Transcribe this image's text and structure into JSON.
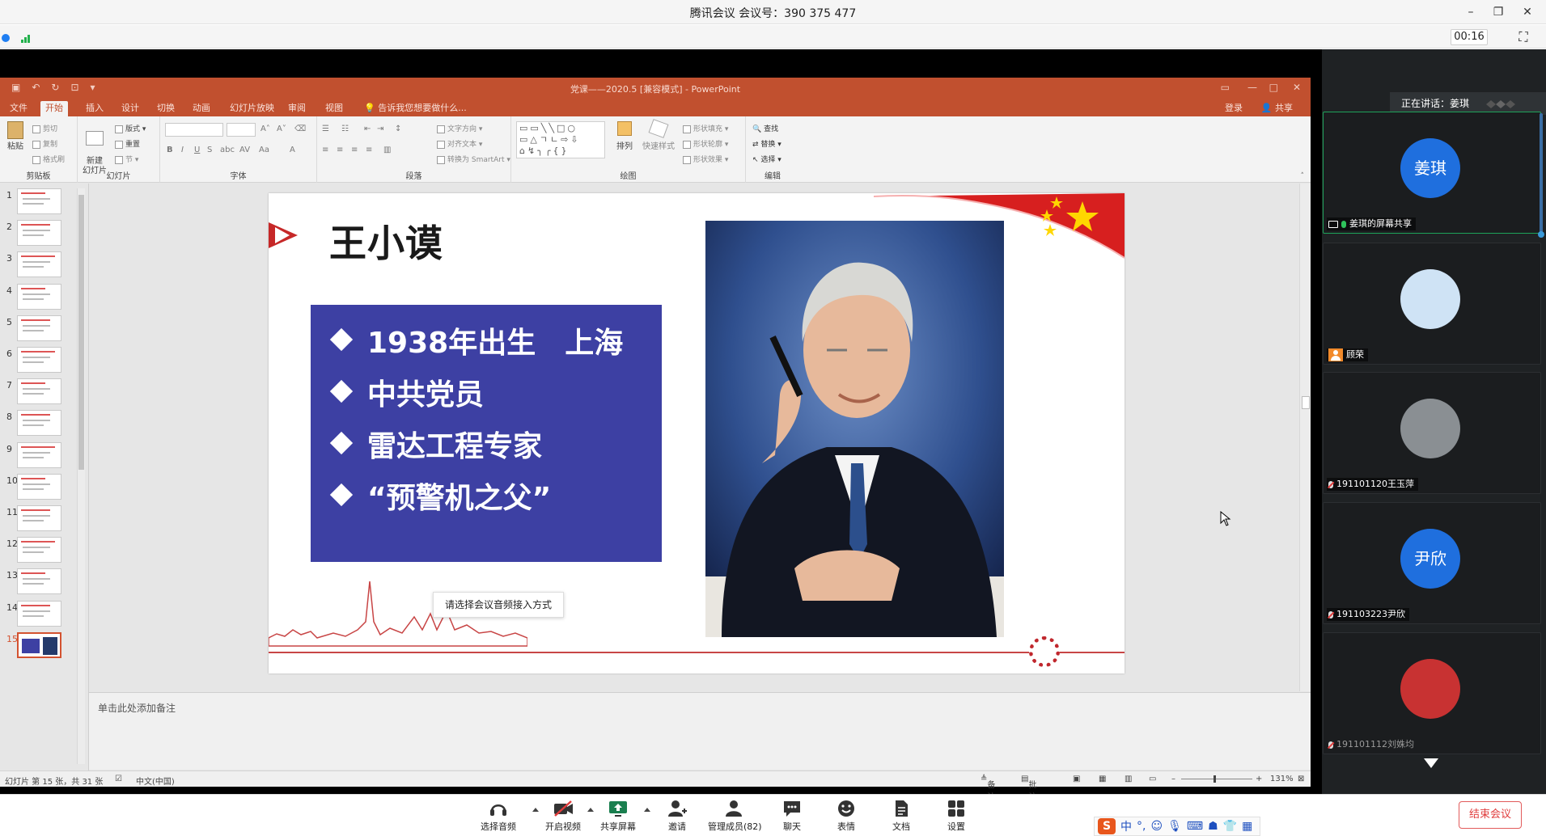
{
  "window": {
    "title": "腾讯会议 会议号：390 375 477",
    "minimize": "–",
    "restore": "❐",
    "close": "✕",
    "timer": "00:16",
    "fullscreen_icon": "⛶"
  },
  "powerpoint": {
    "title": "党课——2020.5 [兼容模式] - PowerPoint",
    "tabs": [
      "文件",
      "开始",
      "插入",
      "设计",
      "切换",
      "动画",
      "幻灯片放映",
      "审阅",
      "视图"
    ],
    "active_tab": "开始",
    "tell_me": "告诉我您想要做什么...",
    "login": "登录",
    "share": "共享",
    "ribbon": {
      "clipboard": {
        "label": "剪贴板",
        "paste": "粘贴",
        "cut": "剪切",
        "copy": "复制",
        "format_painter": "格式刷"
      },
      "slides": {
        "label": "幻灯片",
        "new_slide": "新建\n幻灯片",
        "layout": "版式",
        "reset": "重置",
        "section": "节"
      },
      "font": {
        "label": "字体"
      },
      "paragraph": {
        "label": "段落",
        "text_direction": "文字方向",
        "align_text": "对齐文本",
        "smartart": "转换为 SmartArt"
      },
      "drawing": {
        "label": "绘图",
        "arrange": "排列",
        "quick_styles": "快速样式",
        "shape_fill": "形状填充",
        "shape_outline": "形状轮廓",
        "shape_effects": "形状效果"
      },
      "editing": {
        "label": "编辑",
        "find": "查找",
        "replace": "替换",
        "select": "选择"
      }
    },
    "slide_count": 15,
    "selected_slide": 15,
    "notes_placeholder": "单击此处添加备注",
    "status": {
      "slide_info": "幻灯片 第 15 张，共 31 张",
      "language": "中文(中国)",
      "notes": "备注",
      "comments": "批注",
      "zoom": "131%"
    }
  },
  "slide": {
    "name": "王小谟",
    "bullets": [
      "1938年出生　上海",
      "中共党员",
      "雷达工程专家",
      "“预警机之父”"
    ],
    "tooltip": "请选择会议音频接入方式"
  },
  "gallery": {
    "speaking": "正在讲话：姜琪",
    "participants": [
      {
        "avatar_text": "姜琪",
        "label": "姜琪的屏幕共享",
        "type": "screen-share",
        "avatar_color": "#1f6fde"
      },
      {
        "avatar_text": "",
        "label": "顾荣",
        "type": "host",
        "avatar_color": "#cfe3f5"
      },
      {
        "avatar_text": "",
        "label": "191101120王玉萍",
        "type": "muted",
        "avatar_color": "#8a8f93"
      },
      {
        "avatar_text": "尹欣",
        "label": "191103223尹欣",
        "type": "muted",
        "avatar_color": "#1f6fde"
      },
      {
        "avatar_text": "",
        "label": "191101112刘姝均",
        "type": "muted-dim",
        "avatar_color": "#c83232"
      }
    ]
  },
  "toolbar": {
    "items": [
      {
        "label": "选择音频",
        "icon": "headset-icon"
      },
      {
        "label": "开启视频",
        "icon": "camera-off-icon"
      },
      {
        "label": "共享屏幕",
        "icon": "share-screen-icon"
      },
      {
        "label": "邀请",
        "icon": "invite-icon"
      },
      {
        "label": "管理成员(82)",
        "icon": "members-icon"
      },
      {
        "label": "聊天",
        "icon": "chat-icon"
      },
      {
        "label": "表情",
        "icon": "emoji-icon"
      },
      {
        "label": "文档",
        "icon": "document-icon"
      },
      {
        "label": "设置",
        "icon": "settings-icon"
      }
    ],
    "end_meeting": "结束会议",
    "ime_text": "中"
  }
}
